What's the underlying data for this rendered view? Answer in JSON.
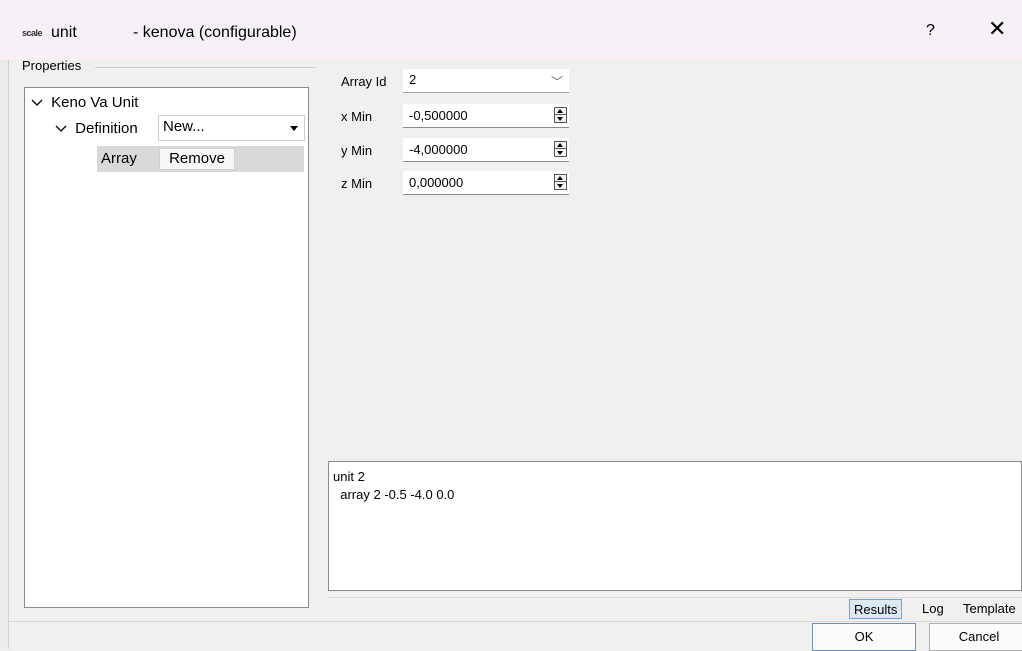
{
  "window": {
    "icon_text": "scale",
    "title": "unit",
    "subtitle": "- kenova (configurable)",
    "help_label": "?",
    "close_label": "✕"
  },
  "properties": {
    "group_label": "Properties",
    "tree": {
      "root_label": "Keno Va Unit",
      "definition_label": "Definition",
      "definition_value": "New...",
      "array_label": "Array",
      "remove_label": "Remove"
    }
  },
  "form": {
    "array_id": {
      "label": "Array Id",
      "value": "2"
    },
    "x_min": {
      "label": "x Min",
      "value": "-0,500000"
    },
    "y_min": {
      "label": "y Min",
      "value": "-4,000000"
    },
    "z_min": {
      "label": "z Min",
      "value": "0,000000"
    }
  },
  "output": {
    "text": "unit 2\n  array 2 -0.5 -4.0 0.0"
  },
  "tabs": [
    "Results",
    "Log",
    "Template"
  ],
  "active_tab": "Results",
  "buttons": {
    "ok": "OK",
    "cancel": "Cancel"
  }
}
